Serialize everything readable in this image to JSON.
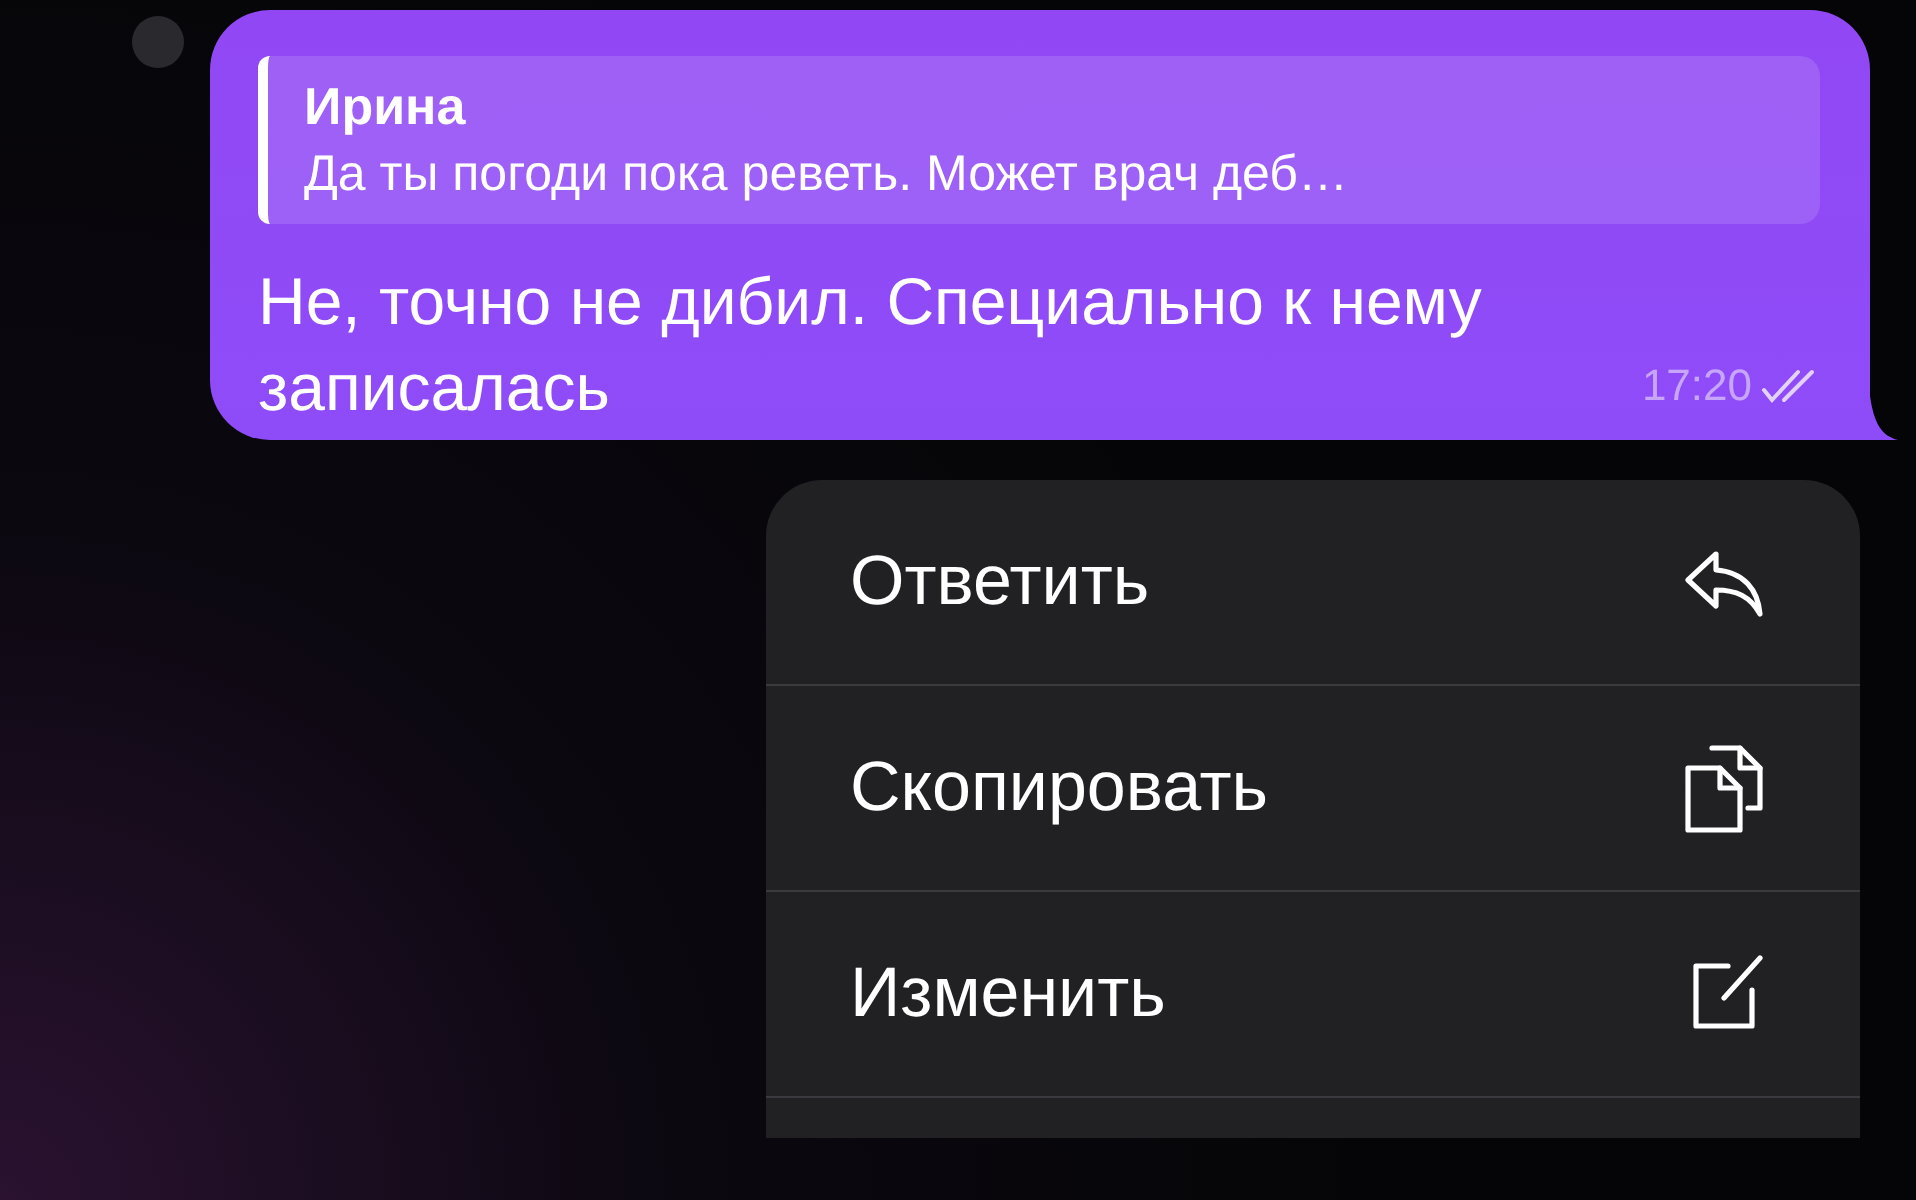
{
  "message": {
    "reply": {
      "author": "Ирина",
      "text": "Да ты погоди пока реветь. Может врач деб…"
    },
    "text": "Не, точно не дибил. Специально к нему записалась",
    "time": "17:20",
    "read": true
  },
  "menu": [
    {
      "label": "Ответить",
      "kind": "reply"
    },
    {
      "label": "Скопировать",
      "kind": "copy"
    },
    {
      "label": "Изменить",
      "kind": "edit"
    }
  ]
}
